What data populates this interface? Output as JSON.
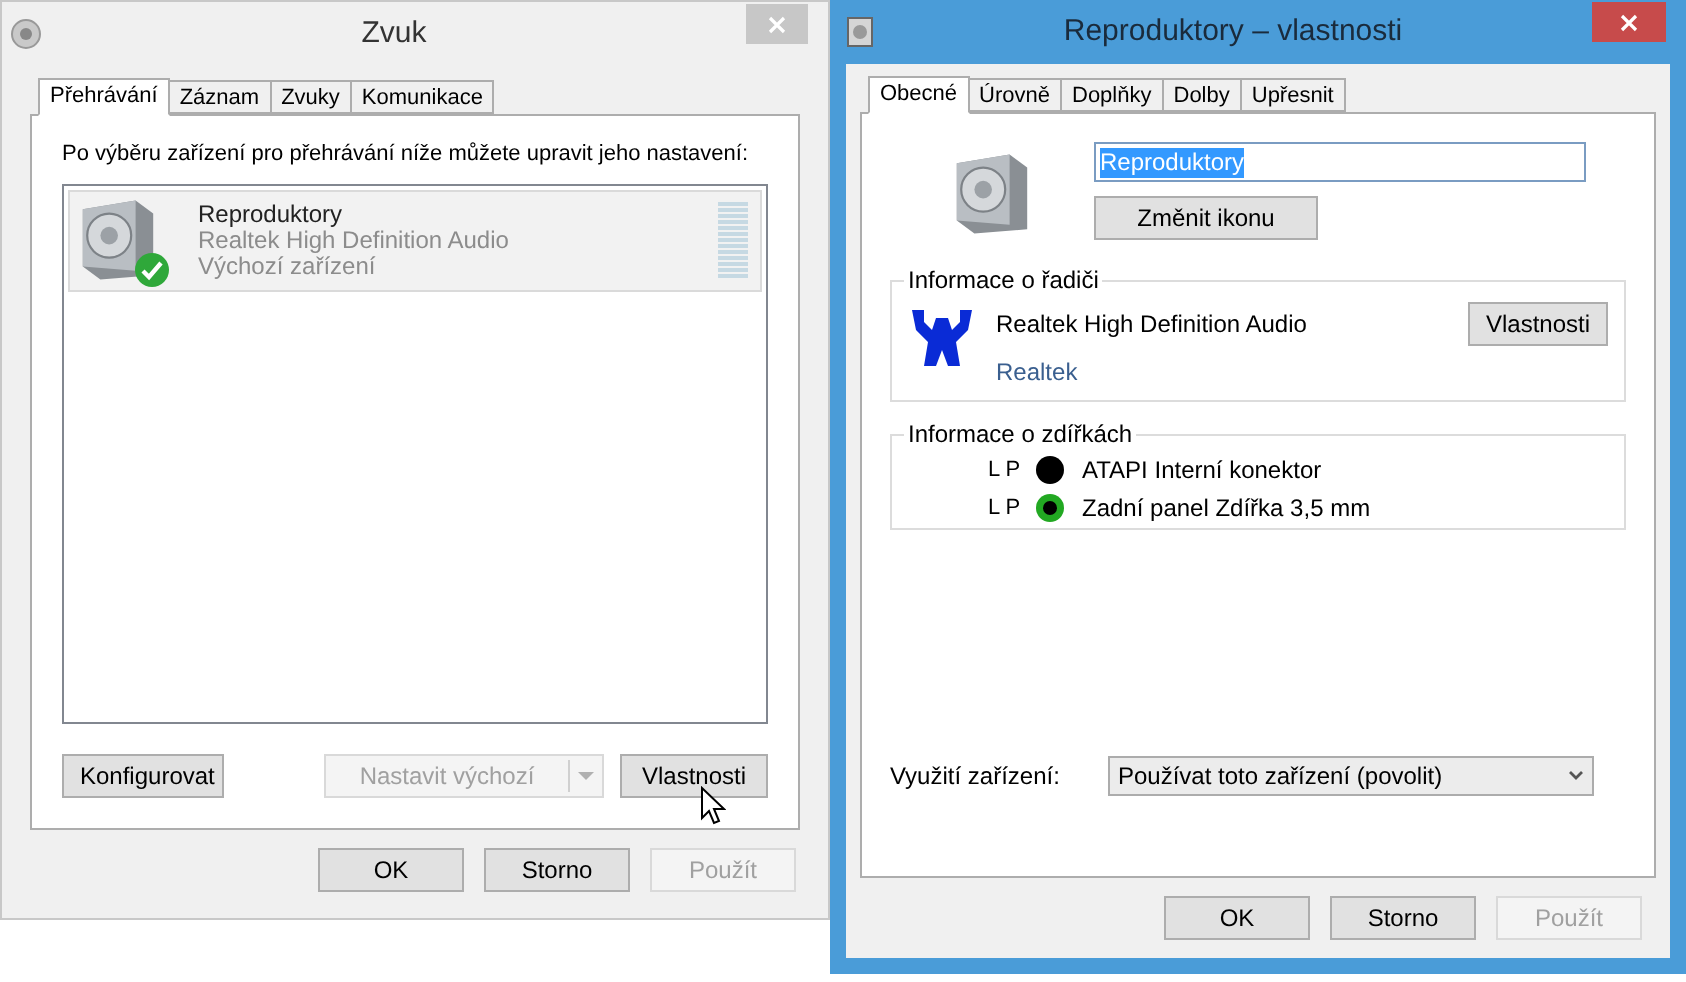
{
  "sound_window": {
    "title": "Zvuk",
    "tabs": [
      {
        "label": "Přehrávání",
        "selected": true
      },
      {
        "label": "Záznam",
        "selected": false
      },
      {
        "label": "Zvuky",
        "selected": false
      },
      {
        "label": "Komunikace",
        "selected": false
      }
    ],
    "instruction": "Po výběru zařízení pro přehrávání níže můžete upravit jeho nastavení:",
    "devices": [
      {
        "name": "Reproduktory",
        "driver": "Realtek High Definition Audio",
        "status": "Výchozí zařízení",
        "selected": true,
        "default": true
      }
    ],
    "configure_button": {
      "label": "Konfigurovat"
    },
    "set_default_button": {
      "label": "Nastavit výchozí",
      "disabled": true
    },
    "properties_button": {
      "label": "Vlastnosti"
    },
    "footer_buttons": [
      {
        "label": "OK",
        "disabled": false
      },
      {
        "label": "Storno",
        "disabled": false
      },
      {
        "label": "Použít",
        "disabled": true
      }
    ]
  },
  "properties_window": {
    "title": "Reproduktory – vlastnosti",
    "tabs": [
      {
        "label": "Obecné",
        "selected": true
      },
      {
        "label": "Úrovně",
        "selected": false
      },
      {
        "label": "Doplňky",
        "selected": false
      },
      {
        "label": "Dolby",
        "selected": false
      },
      {
        "label": "Upřesnit",
        "selected": false
      }
    ],
    "name_field": {
      "value": "Reproduktory"
    },
    "change_icon_button": {
      "label": "Změnit ikonu"
    },
    "controller": {
      "title": "Informace o řadiči",
      "name": "Realtek High Definition Audio",
      "vendor": "Realtek",
      "button": "Vlastnosti"
    },
    "jacks": {
      "title": "Informace o zdířkách",
      "items": [
        {
          "channels": "L P",
          "name": "ATAPI Interní konektor",
          "color": "#000000"
        },
        {
          "channels": "L P",
          "name": "Zadní panel Zdířka 3,5 mm",
          "color": "#22a822"
        }
      ]
    },
    "usage": {
      "label": "Využití zařízení:",
      "value": "Používat toto zařízení (povolit)"
    },
    "footer_buttons": [
      {
        "label": "OK",
        "disabled": false
      },
      {
        "label": "Storno",
        "disabled": false
      },
      {
        "label": "Použít",
        "disabled": true
      }
    ]
  }
}
